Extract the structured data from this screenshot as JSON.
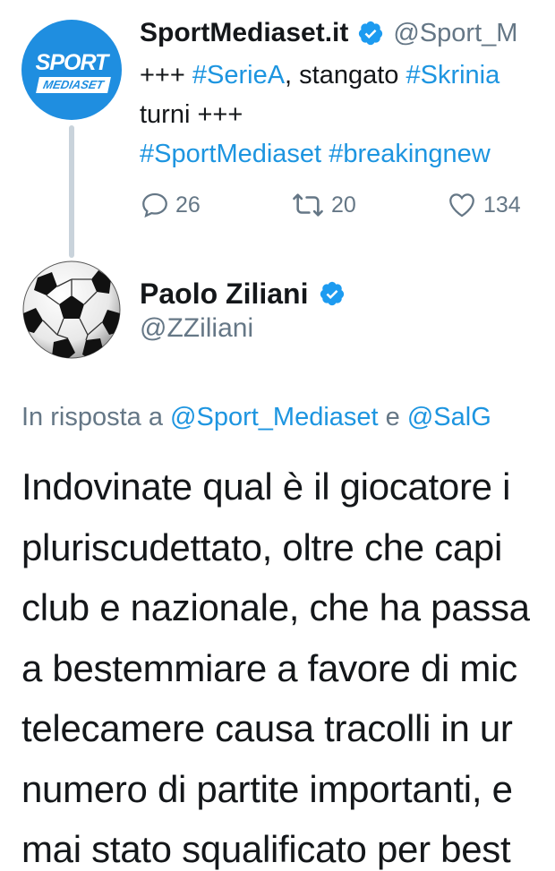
{
  "tweet1": {
    "avatar": {
      "line1": "SPORT",
      "line2": "MEDIASET"
    },
    "name": "SportMediaset.it",
    "verified_icon": "verified-badge-icon",
    "handle": "@Sport_M",
    "text_lines": [
      [
        {
          "t": "+++ ",
          "tag": false
        },
        {
          "t": "#SerieA",
          "tag": true
        },
        {
          "t": ", stangato ",
          "tag": false
        },
        {
          "t": "#Skrinia",
          "tag": true
        }
      ],
      [
        {
          "t": "turni +++",
          "tag": false
        }
      ],
      [
        {
          "t": "#SportMediaset",
          "tag": true
        },
        {
          "t": " ",
          "tag": false
        },
        {
          "t": "#breakingnew",
          "tag": true
        }
      ]
    ],
    "replies": "26",
    "retweets": "20",
    "likes": "134"
  },
  "tweet2": {
    "avatar_icon": "soccer-ball-icon",
    "name": "Paolo Ziliani",
    "handle": "@ZZiliani",
    "reply_prefix": "In risposta a ",
    "mention1": "@Sport_Mediaset",
    "reply_joiner": " e ",
    "mention2": "@SalG",
    "body_lines": [
      "Indovinate qual è il giocatore i",
      "pluriscudettato, oltre che capi",
      "club e nazionale, che ha passa",
      "a bestemmiare a favore di mic",
      "telecamere causa tracolli in ur",
      "numero di partite importanti, e",
      "mai stato squalificato per best"
    ]
  },
  "colors": {
    "link": "#1d95e0",
    "muted": "#657786",
    "brand": "#1f8ee0",
    "thread": "#c9d3db"
  }
}
